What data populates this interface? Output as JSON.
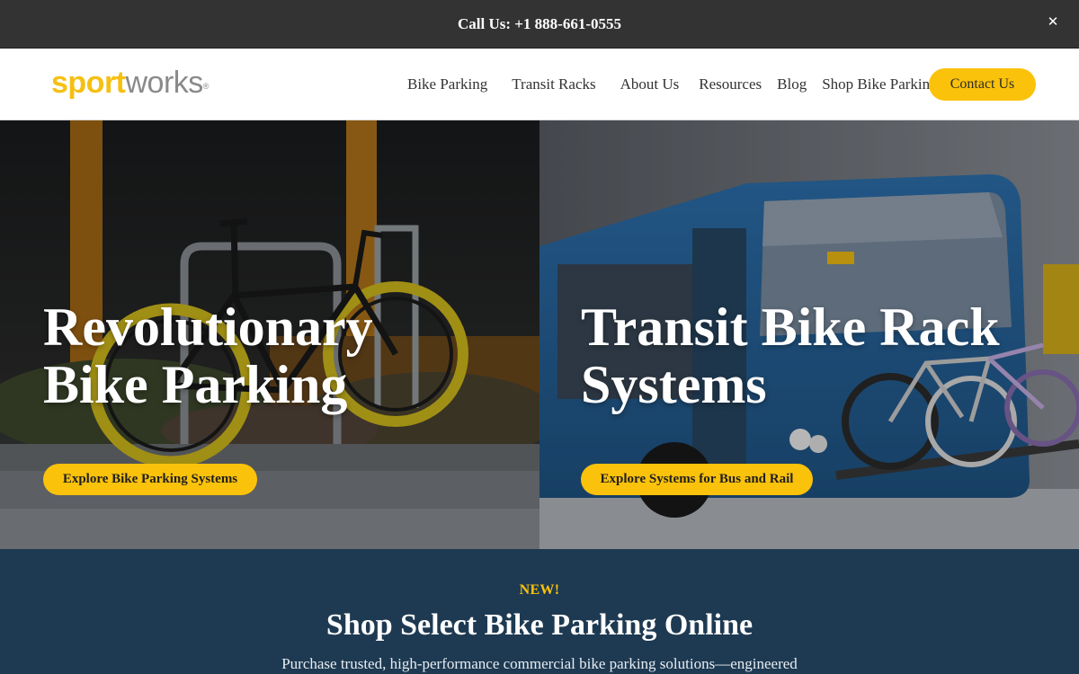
{
  "topbar": {
    "call_text": "Call Us: +1 888-661-0555",
    "close_icon": "close-icon",
    "close_glyph": "✕"
  },
  "header": {
    "logo": {
      "part1": "sport",
      "part2": "works",
      "reg": "®"
    },
    "nav": [
      {
        "label": "Bike Parking"
      },
      {
        "label": "Transit Racks"
      },
      {
        "label": "About Us"
      },
      {
        "label": "Resources"
      },
      {
        "label": "Blog"
      },
      {
        "label": "Shop Bike Parking"
      }
    ],
    "contact_label": "Contact Us"
  },
  "hero": {
    "left": {
      "title_line1": "Revolutionary",
      "title_line2": "Bike Parking",
      "cta_label": "Explore Bike Parking Systems"
    },
    "right": {
      "title_line1": "Transit Bike Rack",
      "title_line2": "Systems",
      "cta_label": "Explore Systems for Bus and Rail"
    }
  },
  "shop": {
    "badge": "NEW!",
    "heading": "Shop Select Bike Parking Online",
    "description": "Purchase trusted, high-performance commercial bike parking solutions—engineered"
  },
  "colors": {
    "accent": "#fbc20b",
    "topbar_bg": "#333333",
    "shop_bg": "#1e3a52",
    "logo_grey": "#8a8a8a"
  }
}
